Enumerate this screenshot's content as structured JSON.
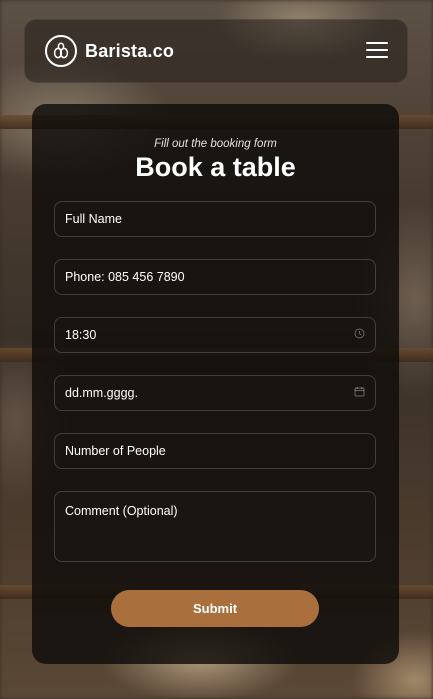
{
  "header": {
    "brand": "Barista.co",
    "menu_icon": "hamburger-menu-icon"
  },
  "form": {
    "subtitle": "Fill out the booking form",
    "title": "Book a table",
    "fields": {
      "full_name": "Full Name",
      "phone": "Phone: 085 456 7890",
      "time": "18:30",
      "date": "dd.mm.gggg.",
      "people": "Number of People",
      "comment": "Comment (Optional)"
    },
    "submit_label": "Submit"
  },
  "colors": {
    "accent": "#a9703d",
    "card_bg": "#0f0c0a",
    "text": "#ffffff"
  }
}
